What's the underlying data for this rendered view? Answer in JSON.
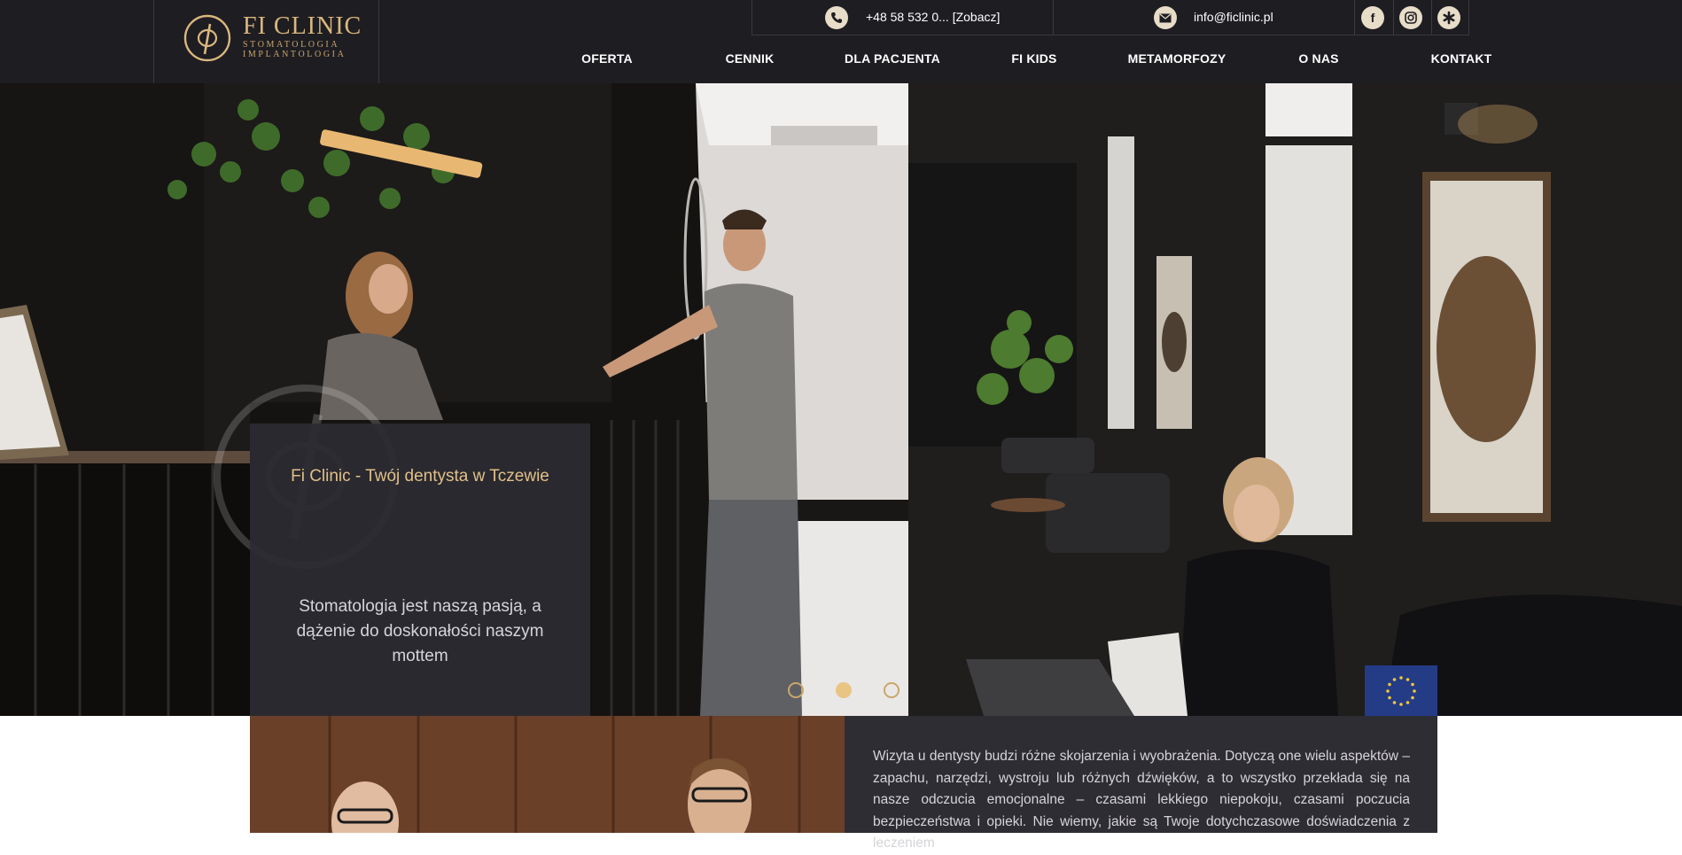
{
  "header": {
    "logo": {
      "title": "FI CLINIC",
      "subtitle_line1": "STOMATOLOGIA",
      "subtitle_line2": "IMPLANTOLOGIA",
      "mark_icon": "phi-logo-icon"
    },
    "contact": {
      "phone_icon": "phone-icon",
      "phone_text": "+48 58 532 0... [Zobacz]",
      "mail_icon": "envelope-icon",
      "email_text": "info@ficlinic.pl"
    },
    "social": [
      {
        "name": "facebook",
        "icon": "facebook-icon",
        "glyph": "f"
      },
      {
        "name": "instagram",
        "icon": "instagram-icon",
        "glyph": ""
      },
      {
        "name": "znanylekarz",
        "icon": "asterisk-icon",
        "glyph": ""
      }
    ],
    "nav": [
      "OFERTA",
      "CENNIK",
      "DLA PACJENTA",
      "FI KIDS",
      "METAMORFOZY",
      "O NAS",
      "KONTAKT"
    ]
  },
  "hero": {
    "title": "Fi Clinic - Twój dentysta w Tczewie",
    "text": "Stomatologia jest naszą pasją, a dążenie do doskonałości naszym mottem",
    "slides_count": 3,
    "active_slide": 2
  },
  "intro": {
    "text": "Wizyta u dentysty budzi różne skojarzenia i wyobrażenia. Dotyczą one wielu aspektów – zapachu, narzędzi, wystroju lub różnych dźwięków, a to wszystko przekłada się na nasze odczucia emocjonalne – czasami lekkiego niepokoju, czasami poczucia bezpieczeństwa i opieki. Nie wiemy, jakie są Twoje dotychczasowe doświadczenia z leczeniem"
  },
  "colors": {
    "header_bg": "#1e1d22",
    "gold": "#d9b77e",
    "dot_active": "#e8c583",
    "panel_bg": "#2c2b31"
  }
}
